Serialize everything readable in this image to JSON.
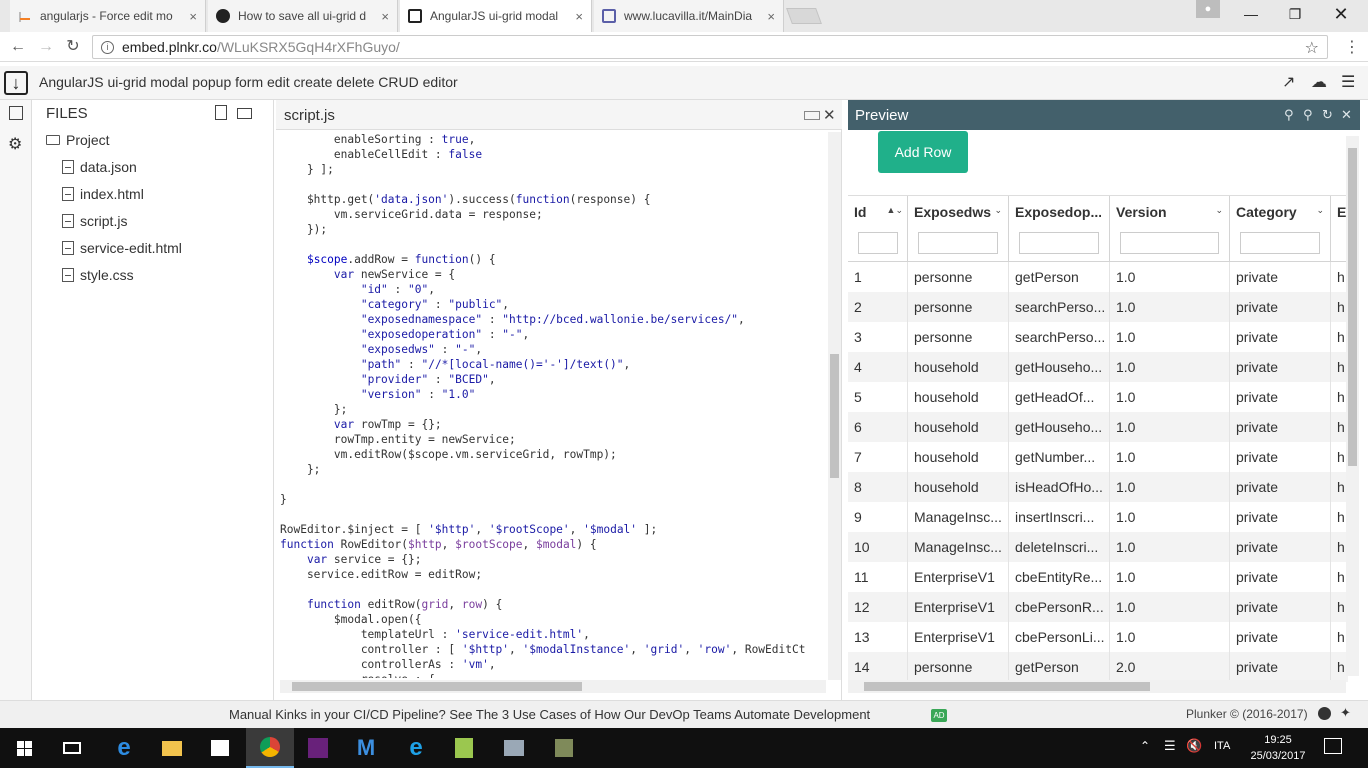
{
  "browser": {
    "tabs": [
      {
        "title": "angularjs - Force edit mo",
        "icon": "stackoverflow-icon",
        "active": false
      },
      {
        "title": "How to save all ui-grid d",
        "icon": "github-icon",
        "active": false
      },
      {
        "title": "AngularJS ui-grid modal",
        "icon": "plunker-icon",
        "active": true
      },
      {
        "title": "www.lucavilla.it/MainDia",
        "icon": "page-icon",
        "active": false
      }
    ],
    "close_glyph": "×",
    "url_domain": "embed.plnkr.co",
    "url_path": "/WLuKSRX5GqH4rXFhGuyo/"
  },
  "plunker": {
    "title": "AngularJS ui-grid modal popup form edit create delete CRUD editor"
  },
  "files": {
    "header": "FILES",
    "project": "Project",
    "items": [
      "data.json",
      "index.html",
      "script.js",
      "service-edit.html",
      "style.css"
    ]
  },
  "editor": {
    "filename": "script.js"
  },
  "preview": {
    "title": "Preview",
    "add_row_label": "Add Row",
    "columns": [
      "Id",
      "Exposedws",
      "Exposedop...",
      "Version",
      "Category",
      "E"
    ],
    "rows": [
      [
        "1",
        "personne",
        "getPerson",
        "1.0",
        "private",
        "h"
      ],
      [
        "2",
        "personne",
        "searchPerso...",
        "1.0",
        "private",
        "h"
      ],
      [
        "3",
        "personne",
        "searchPerso...",
        "1.0",
        "private",
        "h"
      ],
      [
        "4",
        "household",
        "getHouseho...",
        "1.0",
        "private",
        "h"
      ],
      [
        "5",
        "household",
        "getHeadOf...",
        "1.0",
        "private",
        "h"
      ],
      [
        "6",
        "household",
        "getHouseho...",
        "1.0",
        "private",
        "h"
      ],
      [
        "7",
        "household",
        "getNumber...",
        "1.0",
        "private",
        "h"
      ],
      [
        "8",
        "household",
        "isHeadOfHo...",
        "1.0",
        "private",
        "h"
      ],
      [
        "9",
        "ManageInsc...",
        "insertInscri...",
        "1.0",
        "private",
        "h"
      ],
      [
        "10",
        "ManageInsc...",
        "deleteInscri...",
        "1.0",
        "private",
        "h"
      ],
      [
        "11",
        "EnterpriseV1",
        "cbeEntityRe...",
        "1.0",
        "private",
        "h"
      ],
      [
        "12",
        "EnterpriseV1",
        "cbePersonR...",
        "1.0",
        "private",
        "h"
      ],
      [
        "13",
        "EnterpriseV1",
        "cbePersonLi...",
        "1.0",
        "private",
        "h"
      ],
      [
        "14",
        "personne",
        "getPerson",
        "2.0",
        "private",
        "h"
      ]
    ]
  },
  "footer": {
    "ad_text": "Manual Kinks in your CI/CD Pipeline? See The 3 Use Cases of How Our DevOp Teams Automate Development",
    "ad_badge": "AD",
    "copyright": "Plunker © (2016-2017)"
  },
  "taskbar": {
    "lang": "ITA",
    "time": "19:25",
    "date": "25/03/2017"
  },
  "colors": {
    "preview_header": "#43606b",
    "add_button": "#20b08a",
    "taskbar": "#101010"
  }
}
